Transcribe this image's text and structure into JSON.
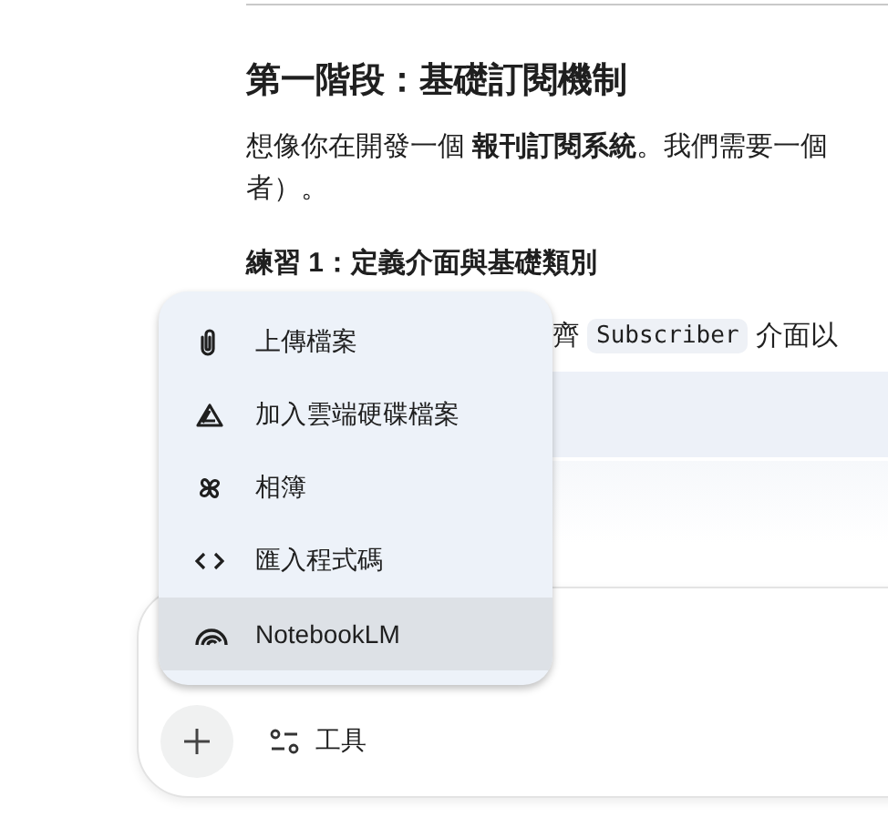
{
  "document": {
    "heading": "第一階段：基礎訂閱機制",
    "paragraph": "想像你在開發一個 **報刊訂閱系統**。我們需要一個",
    "paragraph_cont": "者）。",
    "exercise_heading": "練習 1：定義介面與基礎類別",
    "instruction_parts": [
      {
        "kind": "text",
        "text": "齊"
      },
      {
        "kind": "code",
        "text": "Subscriber"
      },
      {
        "kind": "text",
        "text": "介面以"
      }
    ]
  },
  "attach_menu": {
    "items": [
      {
        "kind": "paperclip",
        "label": "上傳檔案",
        "selected": false
      },
      {
        "kind": "drive",
        "label": "加入雲端硬碟檔案",
        "selected": false
      },
      {
        "kind": "pinwheel",
        "label": "相簿",
        "selected": false
      },
      {
        "kind": "code",
        "label": "匯入程式碼",
        "selected": false
      },
      {
        "kind": "notebook",
        "label": "NotebookLM",
        "selected": true
      }
    ]
  },
  "prompt": {
    "tools_label": "工具"
  }
}
